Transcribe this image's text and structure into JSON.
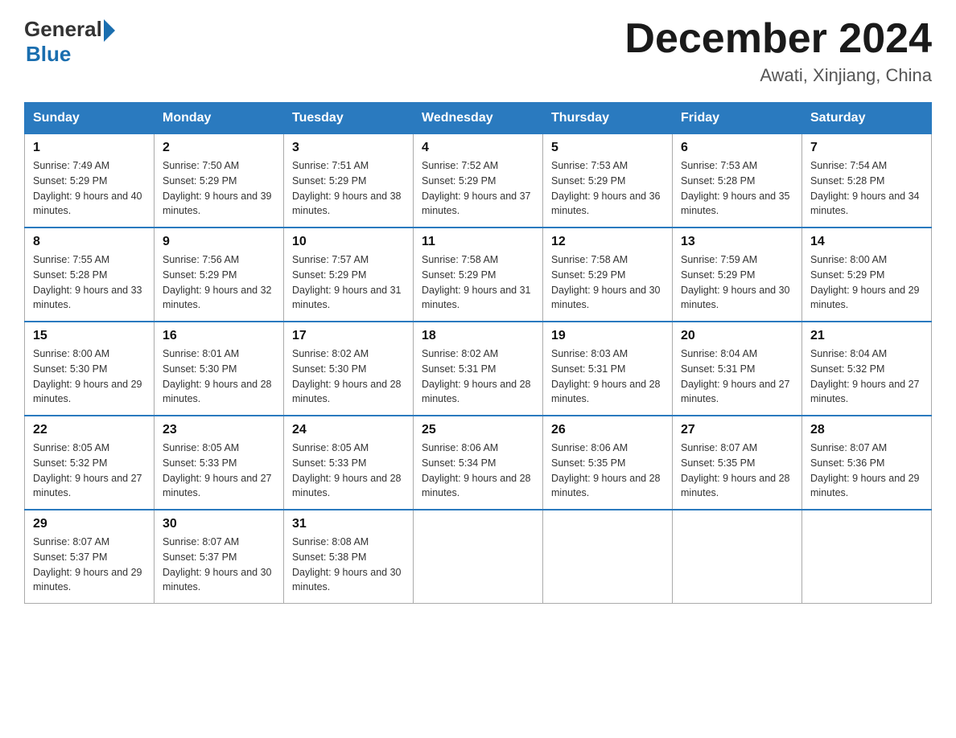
{
  "header": {
    "logo_general": "General",
    "logo_blue": "Blue",
    "title": "December 2024",
    "subtitle": "Awati, Xinjiang, China"
  },
  "days_of_week": [
    "Sunday",
    "Monday",
    "Tuesday",
    "Wednesday",
    "Thursday",
    "Friday",
    "Saturday"
  ],
  "weeks": [
    [
      {
        "day": "1",
        "sunrise": "7:49 AM",
        "sunset": "5:29 PM",
        "daylight": "9 hours and 40 minutes."
      },
      {
        "day": "2",
        "sunrise": "7:50 AM",
        "sunset": "5:29 PM",
        "daylight": "9 hours and 39 minutes."
      },
      {
        "day": "3",
        "sunrise": "7:51 AM",
        "sunset": "5:29 PM",
        "daylight": "9 hours and 38 minutes."
      },
      {
        "day": "4",
        "sunrise": "7:52 AM",
        "sunset": "5:29 PM",
        "daylight": "9 hours and 37 minutes."
      },
      {
        "day": "5",
        "sunrise": "7:53 AM",
        "sunset": "5:29 PM",
        "daylight": "9 hours and 36 minutes."
      },
      {
        "day": "6",
        "sunrise": "7:53 AM",
        "sunset": "5:28 PM",
        "daylight": "9 hours and 35 minutes."
      },
      {
        "day": "7",
        "sunrise": "7:54 AM",
        "sunset": "5:28 PM",
        "daylight": "9 hours and 34 minutes."
      }
    ],
    [
      {
        "day": "8",
        "sunrise": "7:55 AM",
        "sunset": "5:28 PM",
        "daylight": "9 hours and 33 minutes."
      },
      {
        "day": "9",
        "sunrise": "7:56 AM",
        "sunset": "5:29 PM",
        "daylight": "9 hours and 32 minutes."
      },
      {
        "day": "10",
        "sunrise": "7:57 AM",
        "sunset": "5:29 PM",
        "daylight": "9 hours and 31 minutes."
      },
      {
        "day": "11",
        "sunrise": "7:58 AM",
        "sunset": "5:29 PM",
        "daylight": "9 hours and 31 minutes."
      },
      {
        "day": "12",
        "sunrise": "7:58 AM",
        "sunset": "5:29 PM",
        "daylight": "9 hours and 30 minutes."
      },
      {
        "day": "13",
        "sunrise": "7:59 AM",
        "sunset": "5:29 PM",
        "daylight": "9 hours and 30 minutes."
      },
      {
        "day": "14",
        "sunrise": "8:00 AM",
        "sunset": "5:29 PM",
        "daylight": "9 hours and 29 minutes."
      }
    ],
    [
      {
        "day": "15",
        "sunrise": "8:00 AM",
        "sunset": "5:30 PM",
        "daylight": "9 hours and 29 minutes."
      },
      {
        "day": "16",
        "sunrise": "8:01 AM",
        "sunset": "5:30 PM",
        "daylight": "9 hours and 28 minutes."
      },
      {
        "day": "17",
        "sunrise": "8:02 AM",
        "sunset": "5:30 PM",
        "daylight": "9 hours and 28 minutes."
      },
      {
        "day": "18",
        "sunrise": "8:02 AM",
        "sunset": "5:31 PM",
        "daylight": "9 hours and 28 minutes."
      },
      {
        "day": "19",
        "sunrise": "8:03 AM",
        "sunset": "5:31 PM",
        "daylight": "9 hours and 28 minutes."
      },
      {
        "day": "20",
        "sunrise": "8:04 AM",
        "sunset": "5:31 PM",
        "daylight": "9 hours and 27 minutes."
      },
      {
        "day": "21",
        "sunrise": "8:04 AM",
        "sunset": "5:32 PM",
        "daylight": "9 hours and 27 minutes."
      }
    ],
    [
      {
        "day": "22",
        "sunrise": "8:05 AM",
        "sunset": "5:32 PM",
        "daylight": "9 hours and 27 minutes."
      },
      {
        "day": "23",
        "sunrise": "8:05 AM",
        "sunset": "5:33 PM",
        "daylight": "9 hours and 27 minutes."
      },
      {
        "day": "24",
        "sunrise": "8:05 AM",
        "sunset": "5:33 PM",
        "daylight": "9 hours and 28 minutes."
      },
      {
        "day": "25",
        "sunrise": "8:06 AM",
        "sunset": "5:34 PM",
        "daylight": "9 hours and 28 minutes."
      },
      {
        "day": "26",
        "sunrise": "8:06 AM",
        "sunset": "5:35 PM",
        "daylight": "9 hours and 28 minutes."
      },
      {
        "day": "27",
        "sunrise": "8:07 AM",
        "sunset": "5:35 PM",
        "daylight": "9 hours and 28 minutes."
      },
      {
        "day": "28",
        "sunrise": "8:07 AM",
        "sunset": "5:36 PM",
        "daylight": "9 hours and 29 minutes."
      }
    ],
    [
      {
        "day": "29",
        "sunrise": "8:07 AM",
        "sunset": "5:37 PM",
        "daylight": "9 hours and 29 minutes."
      },
      {
        "day": "30",
        "sunrise": "8:07 AM",
        "sunset": "5:37 PM",
        "daylight": "9 hours and 30 minutes."
      },
      {
        "day": "31",
        "sunrise": "8:08 AM",
        "sunset": "5:38 PM",
        "daylight": "9 hours and 30 minutes."
      },
      null,
      null,
      null,
      null
    ]
  ]
}
